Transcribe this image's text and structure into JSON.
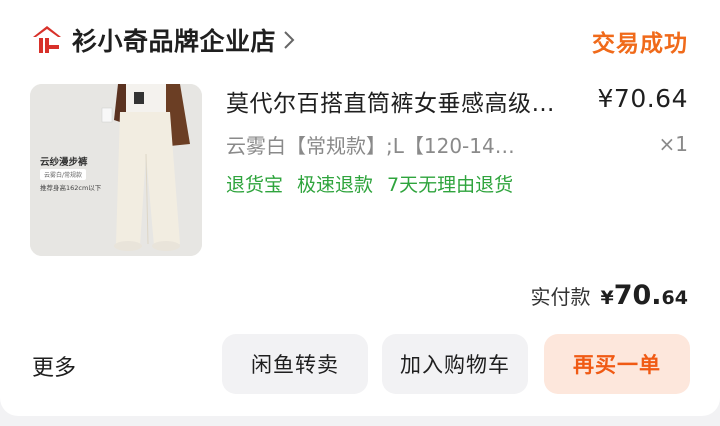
{
  "shop": {
    "name": "衫小奇品牌企业店",
    "icon": "shop-logo-icon",
    "status": "交易成功"
  },
  "item": {
    "title": "莫代尔百搭直筒裤女垂感高级…",
    "price": "¥70.64",
    "spec": "云雾白【常规款】;L【120-14…",
    "quantity": "×1",
    "services": [
      "退货宝",
      "极速退款",
      "7天无理由退货"
    ],
    "image": {
      "title": "云纱漫步裤",
      "tag": "云雾白/常规款",
      "note": "推荐身高162cm以下"
    }
  },
  "payment": {
    "label": "实付款",
    "currency": "¥",
    "integer": "70.",
    "decimal": "64"
  },
  "actions": {
    "more": "更多",
    "idle_fish": "闲鱼转卖",
    "add_cart": "加入购物车",
    "rebuy": "再买一单"
  },
  "colors": {
    "accent": "#f06a1a",
    "service_green": "#2fa43d",
    "logo_red": "#d8312a"
  }
}
